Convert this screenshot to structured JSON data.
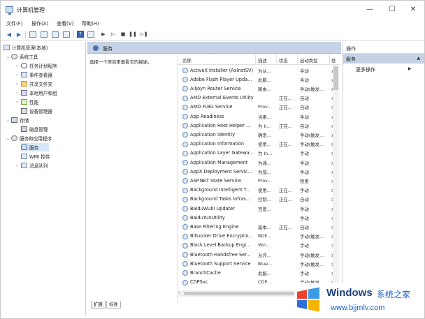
{
  "window": {
    "title": "计算机管理",
    "controls": {
      "minimize": "—",
      "maximize": "☐",
      "close": "✕"
    }
  },
  "menu": [
    "文件(F)",
    "操作(A)",
    "查看(V)",
    "帮助(H)"
  ],
  "toolbar": {
    "back": "◀",
    "forward": "▶",
    "help": "?",
    "start": "▶",
    "play": "▷",
    "stop": "■",
    "pause": "❚❚",
    "restart": "▷❚"
  },
  "tree": {
    "root": "计算机管理(本地)",
    "system_tools": "系统工具",
    "task_scheduler": "任务计划程序",
    "event_viewer": "事件查看器",
    "shared_folders": "共享文件夹",
    "local_users": "本地用户和组",
    "performance": "性能",
    "device_manager": "设备管理器",
    "storage": "存储",
    "disk_management": "磁盘管理",
    "services_apps": "服务和应用程序",
    "services": "服务",
    "wmi": "WMI 控件",
    "message_queue": "消息队列"
  },
  "center": {
    "header": "服务",
    "description_hint": "选择一个项目来查看它的描述。",
    "columns": {
      "name": "名称",
      "desc": "描述",
      "status": "状态",
      "startup": "启动类型",
      "more": "登"
    },
    "tabs": [
      "扩展",
      "标准"
    ]
  },
  "services": [
    {
      "name": "ActiveX Installer (AxInstSV)",
      "desc": "为从...",
      "status": "",
      "startup": "手动",
      "more": "本"
    },
    {
      "name": "Adobe Flash Player Upda...",
      "desc": "此服...",
      "status": "",
      "startup": "手动",
      "more": "本"
    },
    {
      "name": "AllJoyn Router Service",
      "desc": "路由...",
      "status": "",
      "startup": "手动(触发...",
      "more": "本"
    },
    {
      "name": "AMD External Events Utility",
      "desc": "",
      "status": "正在...",
      "startup": "自动",
      "more": "本"
    },
    {
      "name": "AMD FUEL Service",
      "desc": "Prov...",
      "status": "正在...",
      "startup": "自动",
      "more": "本"
    },
    {
      "name": "App Readiness",
      "desc": "当用...",
      "status": "",
      "startup": "手动",
      "more": "本"
    },
    {
      "name": "Application Host Helper ...",
      "desc": "为 II...",
      "status": "正在...",
      "startup": "自动",
      "more": "本"
    },
    {
      "name": "Application Identity",
      "desc": "确定...",
      "status": "",
      "startup": "手动(触发...",
      "more": "本"
    },
    {
      "name": "Application Information",
      "desc": "使用...",
      "status": "正在...",
      "startup": "手动(触发...",
      "more": "本"
    },
    {
      "name": "Application Layer Gatewa...",
      "desc": "为 In...",
      "status": "",
      "startup": "手动",
      "more": "本"
    },
    {
      "name": "Application Management",
      "desc": "为通...",
      "status": "",
      "startup": "手动",
      "more": "本"
    },
    {
      "name": "AppX Deployment Servic...",
      "desc": "为部...",
      "status": "",
      "startup": "手动",
      "more": "本"
    },
    {
      "name": "ASP.NET State Service",
      "desc": "Prov...",
      "status": "",
      "startup": "禁用",
      "more": "本"
    },
    {
      "name": "Background Intelligent T...",
      "desc": "使用...",
      "status": "正在...",
      "startup": "手动",
      "more": "本"
    },
    {
      "name": "Background Tasks Infras...",
      "desc": "控制...",
      "status": "正在...",
      "startup": "自动",
      "more": "本"
    },
    {
      "name": "BaiduWubi Updater",
      "desc": "百度...",
      "status": "",
      "startup": "手动",
      "more": "本"
    },
    {
      "name": "BaiduYunUtility",
      "desc": "",
      "status": "",
      "startup": "手动",
      "more": "本"
    },
    {
      "name": "Base Filtering Engine",
      "desc": "基本...",
      "status": "正在...",
      "startup": "自动",
      "more": "本"
    },
    {
      "name": "BitLocker Drive Encryptio...",
      "desc": "BDE...",
      "status": "",
      "startup": "手动(触发...",
      "more": "本"
    },
    {
      "name": "Block Level Backup Engi...",
      "desc": "Win...",
      "status": "",
      "startup": "手动",
      "more": "本"
    },
    {
      "name": "Bluetooth Handsfree Ser...",
      "desc": "允许...",
      "status": "",
      "startup": "手动(触发...",
      "more": "本"
    },
    {
      "name": "Bluetooth Support Service",
      "desc": "Blue...",
      "status": "",
      "startup": "手动(触发...",
      "more": "本"
    },
    {
      "name": "BranchCache",
      "desc": "此服...",
      "status": "",
      "startup": "手动",
      "more": "本"
    },
    {
      "name": "CDPSvc",
      "desc": "CDP...",
      "status": "",
      "startup": "手动(触发...",
      "more": "本"
    }
  ],
  "actions": {
    "title": "操作",
    "section": "服务",
    "section_arrow": "▲",
    "more": "更多操作",
    "more_arrow": "▶"
  },
  "watermark": {
    "brand": "Windows",
    "cn": "系统之家",
    "url": "www.bjjmlv.com"
  }
}
